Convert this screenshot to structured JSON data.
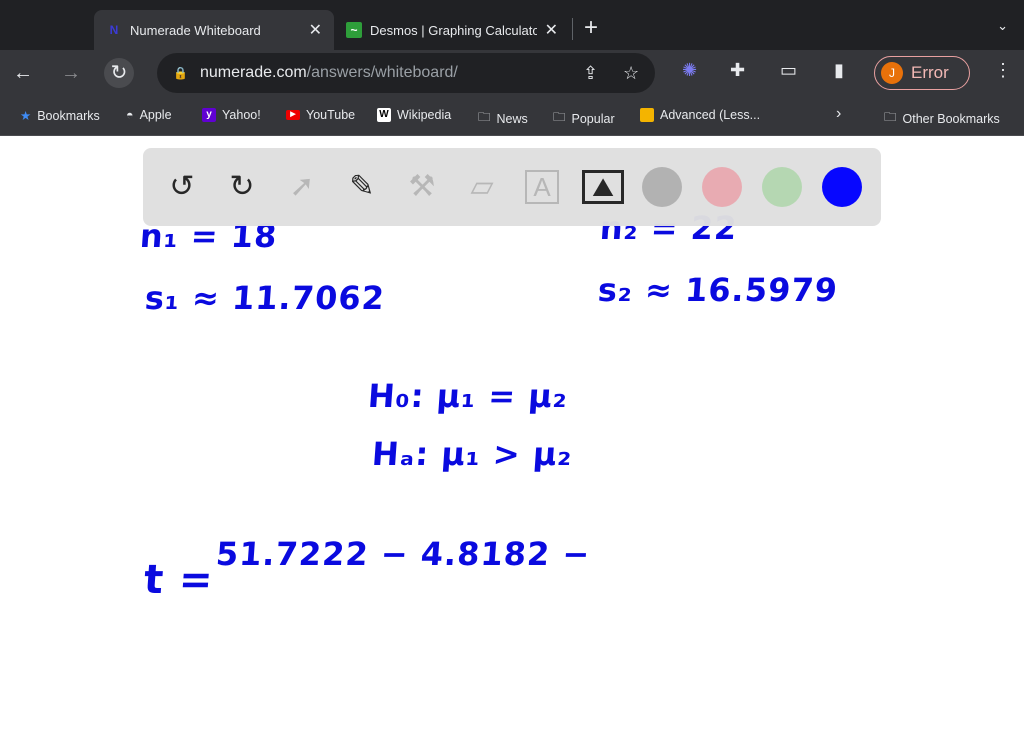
{
  "browser": {
    "tabs": [
      {
        "title": "Numerade Whiteboard",
        "active": true,
        "icon": "numerade-icon"
      },
      {
        "title": "Desmos | Graphing Calculator",
        "active": false,
        "icon": "desmos-icon"
      }
    ],
    "url_host": "numerade.com",
    "url_path": "/answers/whiteboard/",
    "profile_initial": "J",
    "profile_status": "Error",
    "bookmarks": [
      "Bookmarks",
      "Apple",
      "Yahoo!",
      "YouTube",
      "Wikipedia",
      "News",
      "Popular",
      "Advanced (Less...",
      "Other Bookmarks"
    ]
  },
  "whiteboard": {
    "tools": [
      "undo-icon",
      "redo-icon",
      "select-icon",
      "pen-icon",
      "tools-icon",
      "eraser-icon",
      "text-icon",
      "image-icon"
    ],
    "colors": [
      "#b0b0b0",
      "#e8a9b0",
      "#b3d6b0",
      "#0000ff"
    ],
    "selected_color": "#0000ff",
    "notes": {
      "n1": "n₁ = 18",
      "n2": "n₂ = 22",
      "s1": "s₁ ≈ 11.7062",
      "s2": "s₂ ≈ 16.5979",
      "h0": "H₀: μ₁ = μ₂",
      "ha": "Hₐ: μ₁ > μ₂",
      "t_label": "t =",
      "t_numer": "51.7222 − 4.8182 −"
    }
  }
}
